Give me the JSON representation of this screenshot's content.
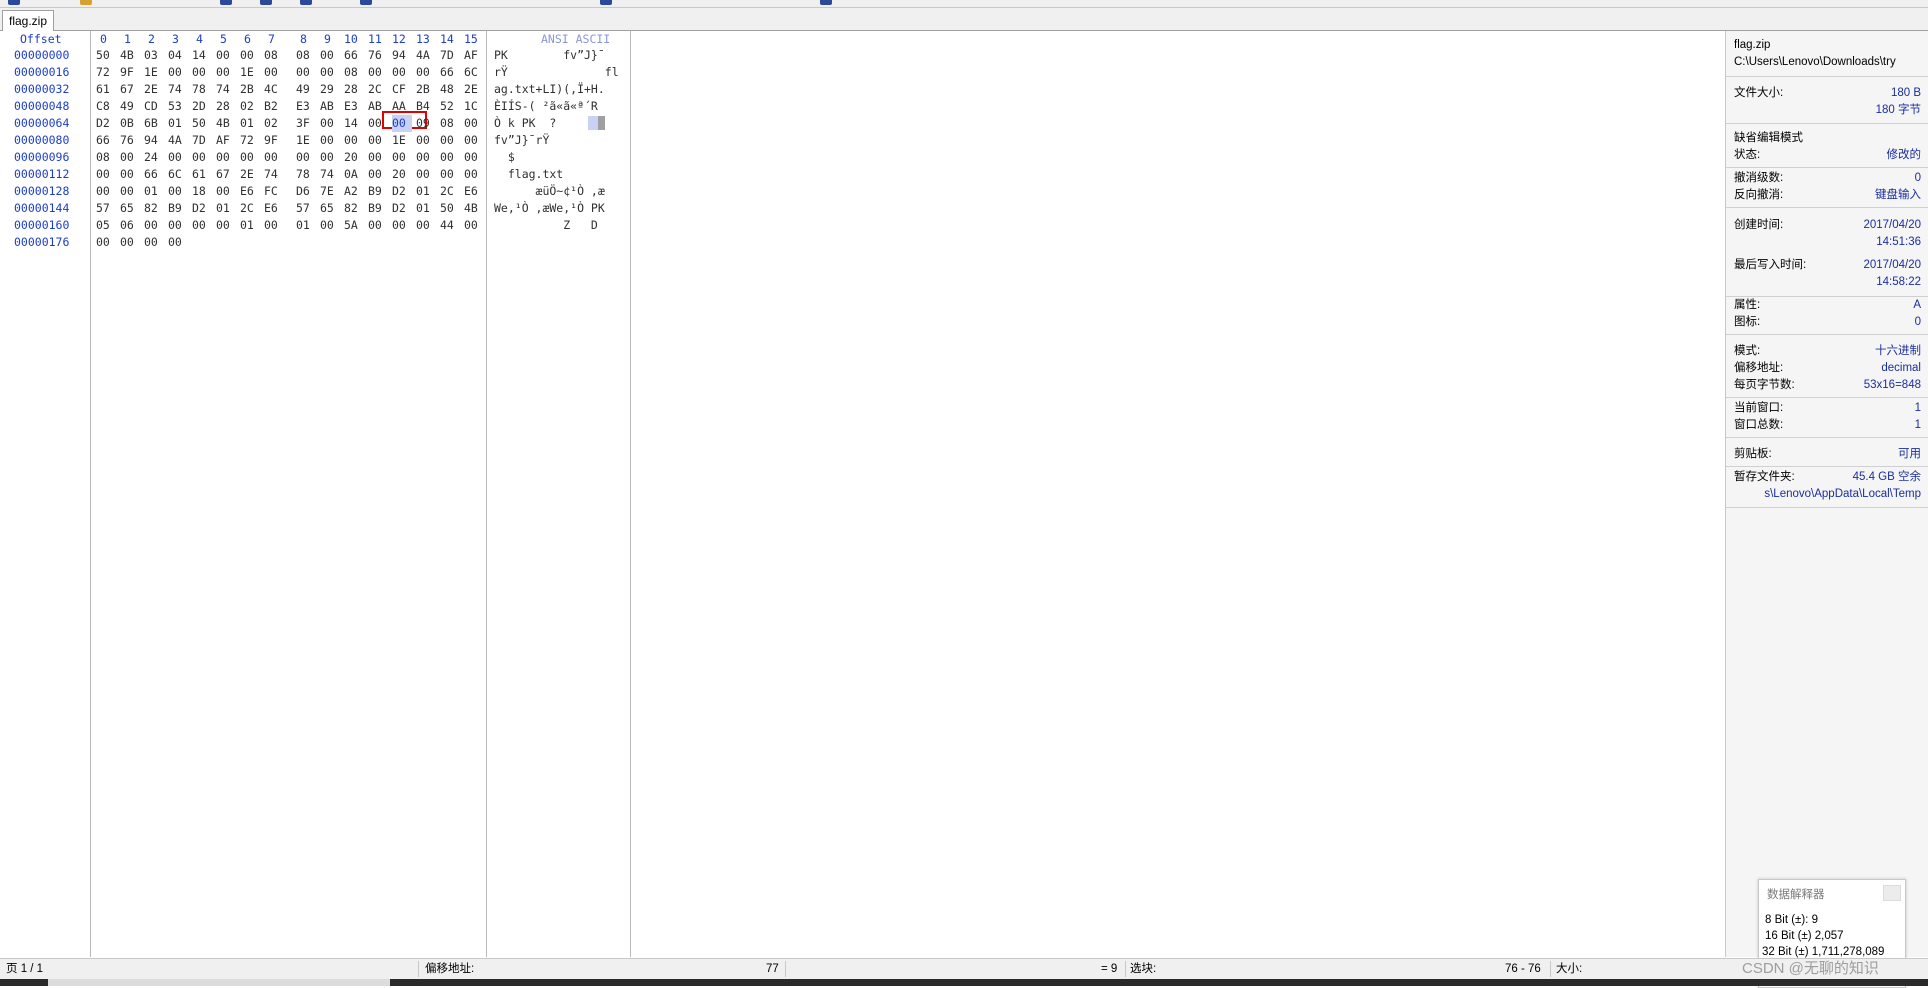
{
  "tab": {
    "label": "flag.zip"
  },
  "hex": {
    "offset_header": "Offset",
    "col_headers": [
      "0",
      "1",
      "2",
      "3",
      "4",
      "5",
      "6",
      "7",
      "8",
      "9",
      "10",
      "11",
      "12",
      "13",
      "14",
      "15"
    ],
    "ascii_header": "ANSI ASCII",
    "rows": [
      {
        "offset": "00000000",
        "bytes": [
          "50",
          "4B",
          "03",
          "04",
          "14",
          "00",
          "00",
          "08",
          "08",
          "00",
          "66",
          "76",
          "94",
          "4A",
          "7D",
          "AF"
        ],
        "ascii": "PK        fv”J}¯"
      },
      {
        "offset": "00000016",
        "bytes": [
          "72",
          "9F",
          "1E",
          "00",
          "00",
          "00",
          "1E",
          "00",
          "00",
          "00",
          "08",
          "00",
          "00",
          "00",
          "66",
          "6C"
        ],
        "ascii": "rŸ              fl"
      },
      {
        "offset": "00000032",
        "bytes": [
          "61",
          "67",
          "2E",
          "74",
          "78",
          "74",
          "2B",
          "4C",
          "49",
          "29",
          "28",
          "2C",
          "CF",
          "2B",
          "48",
          "2E"
        ],
        "ascii": "ag.txt+LI)(,Ï+H."
      },
      {
        "offset": "00000048",
        "bytes": [
          "C8",
          "49",
          "CD",
          "53",
          "2D",
          "28",
          "02",
          "B2",
          "E3",
          "AB",
          "E3",
          "AB",
          "AA",
          "B4",
          "52",
          "1C"
        ],
        "ascii": "ÈIÍS-( ²ã«ã«ª´R"
      },
      {
        "offset": "00000064",
        "bytes": [
          "D2",
          "0B",
          "6B",
          "01",
          "50",
          "4B",
          "01",
          "02",
          "3F",
          "00",
          "14",
          "00",
          "00",
          "09",
          "08",
          "00"
        ],
        "ascii": "Ò k PK  ?"
      },
      {
        "offset": "00000080",
        "bytes": [
          "66",
          "76",
          "94",
          "4A",
          "7D",
          "AF",
          "72",
          "9F",
          "1E",
          "00",
          "00",
          "00",
          "1E",
          "00",
          "00",
          "00"
        ],
        "ascii": "fv”J}¯rŸ"
      },
      {
        "offset": "00000096",
        "bytes": [
          "08",
          "00",
          "24",
          "00",
          "00",
          "00",
          "00",
          "00",
          "00",
          "00",
          "20",
          "00",
          "00",
          "00",
          "00",
          "00"
        ],
        "ascii": "  $"
      },
      {
        "offset": "00000112",
        "bytes": [
          "00",
          "00",
          "66",
          "6C",
          "61",
          "67",
          "2E",
          "74",
          "78",
          "74",
          "0A",
          "00",
          "20",
          "00",
          "00",
          "00"
        ],
        "ascii": "  flag.txt"
      },
      {
        "offset": "00000128",
        "bytes": [
          "00",
          "00",
          "01",
          "00",
          "18",
          "00",
          "E6",
          "FC",
          "D6",
          "7E",
          "A2",
          "B9",
          "D2",
          "01",
          "2C",
          "E6"
        ],
        "ascii": "      æüÖ~¢¹Ò ,æ"
      },
      {
        "offset": "00000144",
        "bytes": [
          "57",
          "65",
          "82",
          "B9",
          "D2",
          "01",
          "2C",
          "E6",
          "57",
          "65",
          "82",
          "B9",
          "D2",
          "01",
          "50",
          "4B"
        ],
        "ascii": "We‚¹Ò ,æWe‚¹Ò PK"
      },
      {
        "offset": "00000160",
        "bytes": [
          "05",
          "06",
          "00",
          "00",
          "00",
          "00",
          "01",
          "00",
          "01",
          "00",
          "5A",
          "00",
          "00",
          "00",
          "44",
          "00"
        ],
        "ascii": "          Z   D"
      },
      {
        "offset": "00000176",
        "bytes": [
          "00",
          "00",
          "00",
          "00"
        ],
        "ascii": ""
      }
    ]
  },
  "panel": {
    "file_name": "flag.zip",
    "file_path": "C:\\Users\\Lenovo\\Downloads\\try",
    "file_size_label": "文件大小:",
    "file_size_value": "180 B",
    "file_size_bytes": "180 字节",
    "edit_mode_title": "缺省编辑模式",
    "state_label": "状态:",
    "state_value": "修改的",
    "undo_level_label": "撤消级数:",
    "undo_level_value": "0",
    "reverse_undo_label": "反向撤消:",
    "reverse_undo_value": "键盘输入",
    "created_label": "创建时间:",
    "created_date": "2017/04/20",
    "created_time": "14:51:36",
    "modified_label": "最后写入时间:",
    "modified_date": "2017/04/20",
    "modified_time": "14:58:22",
    "attr_label": "属性:",
    "attr_value": "A",
    "icon_label": "图标:",
    "icon_value": "0",
    "mode_label": "模式:",
    "mode_value": "十六进制",
    "offset_addr_label": "偏移地址:",
    "offset_addr_value": "decimal",
    "bytes_per_page_label": "每页字节数:",
    "bytes_per_page_value": "53x16=848",
    "current_window_label": "当前窗口:",
    "current_window_value": "1",
    "total_windows_label": "窗口总数:",
    "total_windows_value": "1",
    "clipboard_label": "剪贴板:",
    "clipboard_value": "可用",
    "temp_folder_label": "暂存文件夹:",
    "temp_folder_value": "45.4 GB 空余",
    "temp_folder_path": "s\\Lenovo\\AppData\\Local\\Temp"
  },
  "interpreter": {
    "title": "数据解释器",
    "bit8": "8 Bit (±): 9",
    "bit16": "16 Bit (±) 2,057",
    "bit32": "32 Bit (±) 1,711,278,089"
  },
  "statusbar": {
    "page": "页 1 / 1",
    "offset_label": "偏移地址:",
    "offset_value": "77",
    "equals_value": "= 9",
    "selection_label": "选块:",
    "selection_value": "76 - 76",
    "size_label": "大小:"
  },
  "watermark": "CSDN @无聊的知识"
}
